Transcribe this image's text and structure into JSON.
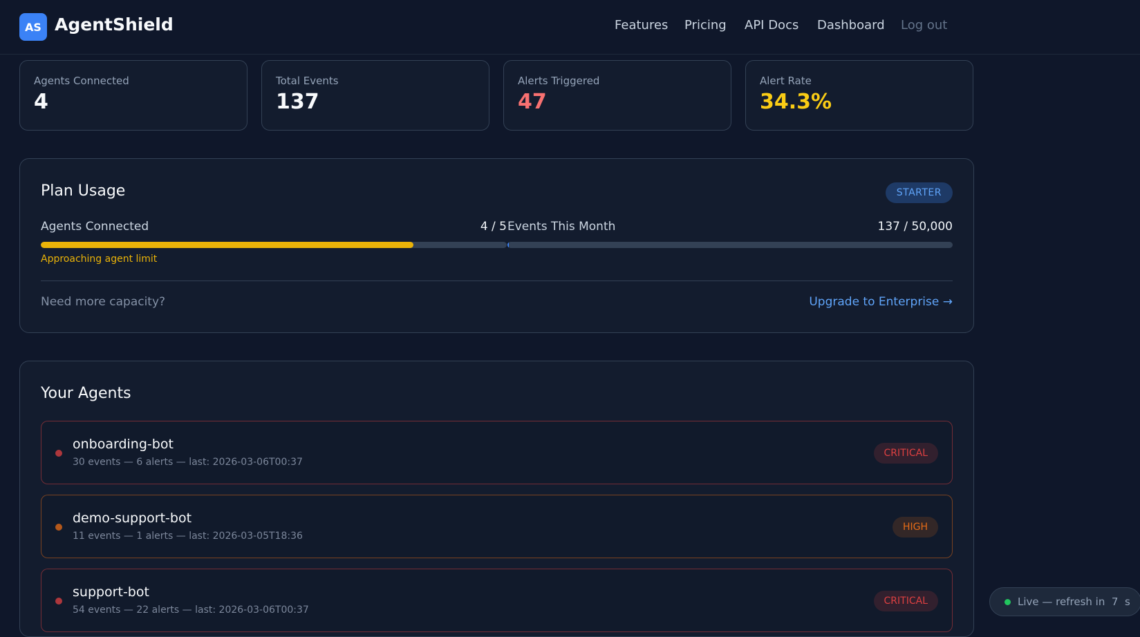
{
  "brand": {
    "logo_text": "AS",
    "name": "AgentShield"
  },
  "nav": {
    "features": "Features",
    "pricing": "Pricing",
    "api_docs": "API Docs",
    "dashboard": "Dashboard",
    "logout": "Log out"
  },
  "stats": [
    {
      "label": "Agents Connected",
      "value": "4",
      "color": "#f8fafc"
    },
    {
      "label": "Total Events",
      "value": "137",
      "color": "#f8fafc"
    },
    {
      "label": "Alerts Triggered",
      "value": "47",
      "color": "#f87171"
    },
    {
      "label": "Alert Rate",
      "value": "34.3%",
      "color": "#facc15"
    }
  ],
  "plan": {
    "title": "Plan Usage",
    "badge": "STARTER",
    "agents": {
      "label": "Agents Connected",
      "value": "4 / 5",
      "fraction": 0.8,
      "color": "#eab308"
    },
    "events": {
      "label": "Events This Month",
      "value": "137 / 50,000",
      "fraction": 0.00274,
      "color": "#3b82f6"
    },
    "warning": "Approaching agent limit",
    "capacity_text": "Need more capacity?",
    "upgrade_link": "Upgrade to Enterprise →"
  },
  "agents_panel": {
    "title": "Your Agents",
    "items": [
      {
        "name": "onboarding-bot",
        "meta": "30 events — 6 alerts — last: 2026-03-06T00:37",
        "severity": "CRITICAL",
        "severity_color": "#ef4444"
      },
      {
        "name": "demo-support-bot",
        "meta": "11 events — 1 alerts — last: 2026-03-05T18:36",
        "severity": "HIGH",
        "severity_color": "#f97316"
      },
      {
        "name": "support-bot",
        "meta": "54 events — 22 alerts — last: 2026-03-06T00:37",
        "severity": "CRITICAL",
        "severity_color": "#ef4444"
      }
    ]
  },
  "live": {
    "text": "Live — refresh in",
    "seconds": "7",
    "unit": "s"
  }
}
